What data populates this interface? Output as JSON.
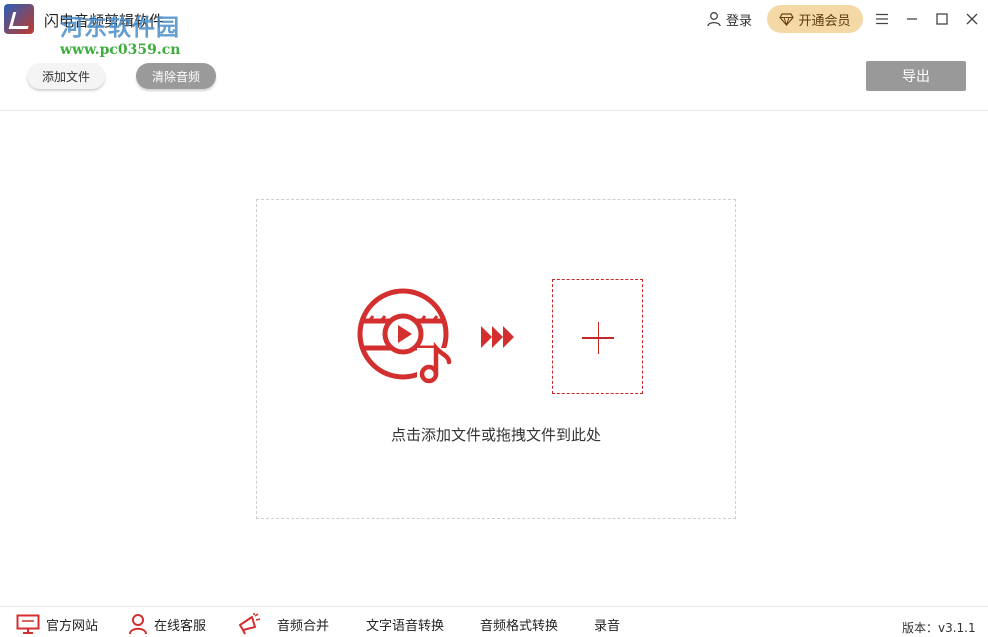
{
  "app": {
    "title": "闪电音频剪辑软件"
  },
  "watermark": {
    "text": "河东软件园",
    "url": "www.pc0359.cn"
  },
  "header": {
    "login_label": "登录",
    "vip_label": "开通会员",
    "vip_color": "#f4d9a6"
  },
  "toolbar": {
    "add_file_label": "添加文件",
    "clear_audio_label": "清除音频",
    "export_label": "导出"
  },
  "dropzone": {
    "hint": "点击添加文件或拖拽文件到此处",
    "accent_color": "#c62828"
  },
  "footer": {
    "items": [
      {
        "label": "官方网站",
        "icon": "monitor-icon"
      },
      {
        "label": "在线客服",
        "icon": "user-icon"
      },
      {
        "label": "音频合并",
        "icon": "bullhorn-icon"
      },
      {
        "label": "文字语音转换"
      },
      {
        "label": "音频格式转换"
      },
      {
        "label": "录音"
      }
    ],
    "version": "版本：v3.1.1"
  }
}
